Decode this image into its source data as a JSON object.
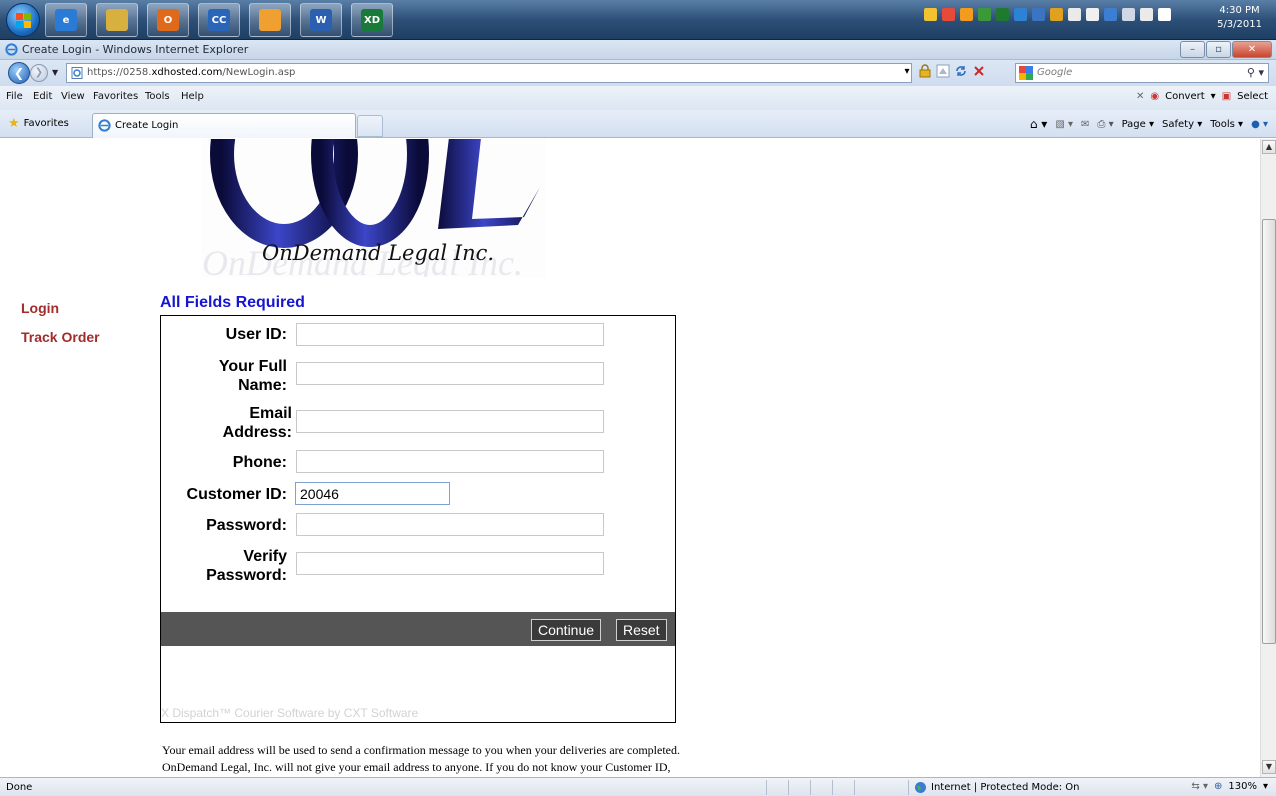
{
  "taskbar": {
    "apps": [
      {
        "icon": "internet-explorer-icon",
        "color": "#2a7bd6",
        "label": "e"
      },
      {
        "icon": "file-explorer-icon",
        "color": "#d8b040",
        "label": ""
      },
      {
        "icon": "outlook-icon",
        "color": "#e06a1c",
        "label": "O"
      },
      {
        "icon": "cc-app-icon",
        "color": "#2a65b8",
        "label": "CC"
      },
      {
        "icon": "calendar-app-icon",
        "color": "#f0a030",
        "label": ""
      },
      {
        "icon": "word-icon",
        "color": "#2b5fb0",
        "label": "W"
      },
      {
        "icon": "xd-hosted-icon",
        "color": "#1a7a3a",
        "label": "XD"
      }
    ],
    "tray_colors": [
      "#f2c230",
      "#e84a3a",
      "#f29b1c",
      "#3a9a3a",
      "#1f7a2f",
      "#2e82d6",
      "#3a74c2",
      "#e0a020",
      "#eaeaea",
      "#f0f0f0",
      "#3b7ed2",
      "#cfd8e4",
      "#eaeaea",
      "#ffffff"
    ],
    "clock_time": "4:30 PM",
    "clock_date": "5/3/2011"
  },
  "window": {
    "title": "Create Login - Windows Internet Explorer",
    "minimize": "–",
    "maximize": "▫",
    "close": "✕"
  },
  "address": {
    "url_prefix": "https://0258.",
    "url_host": "xdhosted.com",
    "url_path": "/NewLogin.asp",
    "search_placeholder": "Google"
  },
  "menu": {
    "items": [
      "File",
      "Edit",
      "View",
      "Favorites",
      "Tools",
      "Help"
    ],
    "convert_label": "Convert",
    "select_label": "Select"
  },
  "favbar": {
    "favorites_label": "Favorites",
    "tab_label": "Create Login",
    "page_label": "Page",
    "safety_label": "Safety",
    "tools_label": "Tools"
  },
  "page": {
    "logo_text": "OnDemand Legal Inc.",
    "nav": {
      "login": "Login",
      "track_order": "Track Order"
    },
    "required_title": "All Fields Required",
    "form": {
      "user_id_label": "User ID:",
      "full_name_label_1": "Your Full",
      "full_name_label_2": "Name:",
      "email_label_1": "Email",
      "email_label_2": "Address:",
      "phone_label": "Phone:",
      "customer_id_label": "Customer ID:",
      "customer_id_value": "20046",
      "password_label": "Password:",
      "verify_label_1": "Verify",
      "verify_label_2": "Password:",
      "continue_label": "Continue",
      "reset_label": "Reset",
      "credit": "X Dispatch™ Courier Software by CXT Software"
    },
    "note_line1": "Your email address will be used to send a confirmation message to you when your deliveries are completed.",
    "note_line2": "OnDemand Legal, Inc. will not give your email address to anyone. If you do not know your Customer ID,"
  },
  "status": {
    "text": "Done",
    "zone": "Internet | Protected Mode: On",
    "zoom": "130%"
  },
  "colors": {
    "nav_link": "#a02c2c",
    "required_title": "#1616d0",
    "button_strip": "#555555"
  }
}
